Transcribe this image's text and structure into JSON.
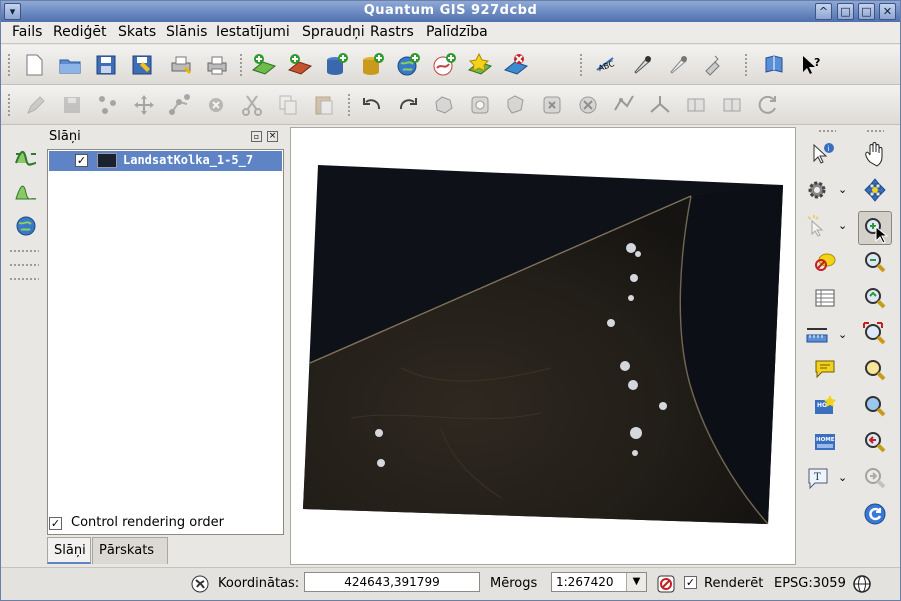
{
  "window": {
    "title": "Quantum GIS 927dcbd"
  },
  "titlebar_buttons": {
    "menu": "▾",
    "shade": "^",
    "minimize": "□",
    "maximize": "□",
    "close": "✕"
  },
  "menu": [
    {
      "label": "Fails"
    },
    {
      "label": "Rediģēt"
    },
    {
      "label": "Skats"
    },
    {
      "label": "Slānis"
    },
    {
      "label": "Iestatījumi"
    },
    {
      "label": "Spraudņi"
    },
    {
      "label": "Rastrs"
    },
    {
      "label": "Palīdzība"
    }
  ],
  "layers_panel": {
    "title": "Slāņi",
    "layers": [
      {
        "name": "LandsatKolka_1-5_7",
        "checked": true
      }
    ],
    "control_rendering_order": "Control rendering order",
    "tabs": [
      {
        "label": "Slāņi"
      },
      {
        "label": "Pārskats"
      }
    ]
  },
  "statusbar": {
    "coordinates_label": "Koordinātas:",
    "coordinates_value": "424643,391799",
    "scale_label": "Mērogs",
    "scale_value": "1:267420",
    "render_label": "Renderēt",
    "epsg": "EPSG:3059"
  },
  "colors": {
    "selection": "#5f84c6",
    "titlebar": "#5d7ab7"
  }
}
